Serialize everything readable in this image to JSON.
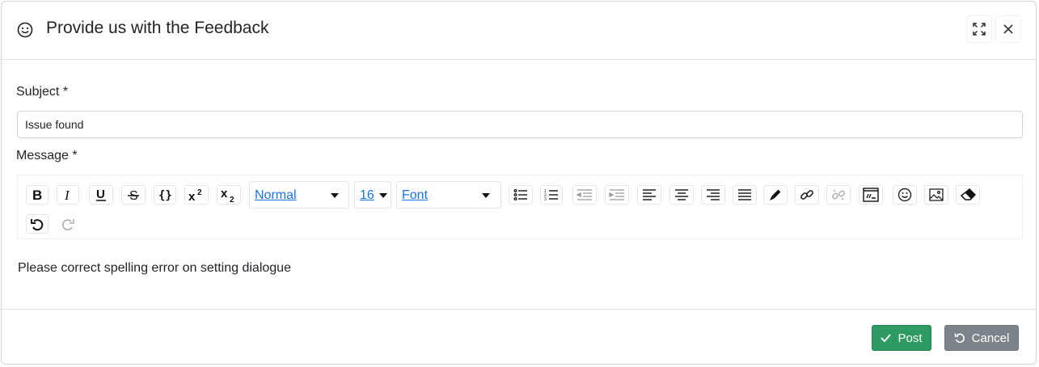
{
  "dialog": {
    "title": "Provide us with the Feedback",
    "title_icon": "smiley-icon",
    "header_buttons": [
      "expand-icon",
      "close-icon"
    ]
  },
  "form": {
    "subject_label": "Subject *",
    "subject_value": "Issue found",
    "message_label": "Message *",
    "message_text": "Please correct spelling error on setting dialogue"
  },
  "toolbar": {
    "style_select": "Normal",
    "size_select": "16",
    "font_select": "Font",
    "tools": [
      "bold",
      "italic",
      "underline",
      "strikethrough",
      "code",
      "superscript",
      "subscript",
      "bullet-list",
      "numbered-list",
      "outdent",
      "indent",
      "align-left",
      "align-center",
      "align-right",
      "justify",
      "text-color",
      "link",
      "unlink",
      "code-view",
      "emoji",
      "image",
      "clear-format",
      "undo",
      "redo"
    ]
  },
  "footer": {
    "post_label": "Post",
    "cancel_label": "Cancel"
  },
  "colors": {
    "post_button": "#2e9b62",
    "cancel_button": "#7c8389",
    "select_text": "#1a73e8"
  }
}
